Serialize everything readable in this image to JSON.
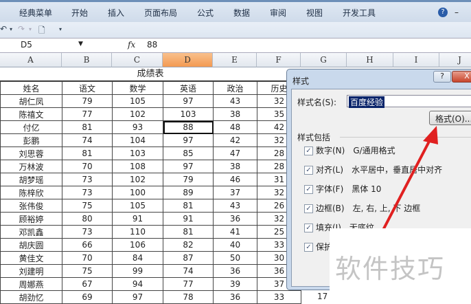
{
  "ribbon": {
    "tabs": [
      "经典菜单",
      "开始",
      "插入",
      "页面布局",
      "公式",
      "数据",
      "审阅",
      "视图",
      "开发工具"
    ],
    "help": "?",
    "minimize": "–"
  },
  "qat": {
    "undo": "↶",
    "undo_drop": "▾",
    "redo": "↷",
    "redo_drop": "▾",
    "preview": "🗋",
    "customize": "▾"
  },
  "formula_bar": {
    "name_box": "D5",
    "fx": "fx",
    "value": "88"
  },
  "columns": [
    "A",
    "B",
    "C",
    "D",
    "E",
    "F",
    "G",
    "H",
    "I",
    "J"
  ],
  "sheet": {
    "title": "成绩表",
    "headers": [
      "姓名",
      "语文",
      "数学",
      "英语",
      "政治",
      "历史"
    ],
    "rows": [
      [
        "胡仁凤",
        "79",
        "105",
        "97",
        "43",
        "32"
      ],
      [
        "陈禧文",
        "77",
        "102",
        "103",
        "38",
        "35"
      ],
      [
        "付亿",
        "81",
        "93",
        "88",
        "48",
        "42"
      ],
      [
        "彭鹏",
        "74",
        "104",
        "97",
        "42",
        "32"
      ],
      [
        "刘思蓉",
        "81",
        "103",
        "85",
        "47",
        "28"
      ],
      [
        "万林波",
        "70",
        "108",
        "97",
        "38",
        "28"
      ],
      [
        "胡梦瑶",
        "73",
        "102",
        "79",
        "46",
        "31"
      ],
      [
        "陈梓欣",
        "73",
        "100",
        "89",
        "37",
        "32"
      ],
      [
        "张伟俊",
        "75",
        "105",
        "81",
        "43",
        "26"
      ],
      [
        "顾裕婷",
        "80",
        "91",
        "91",
        "36",
        "32"
      ],
      [
        "邓凯鑫",
        "73",
        "110",
        "81",
        "41",
        "25"
      ],
      [
        "胡庆圆",
        "66",
        "106",
        "82",
        "40",
        "33"
      ],
      [
        "黄佳文",
        "70",
        "84",
        "87",
        "50",
        "30"
      ],
      [
        "刘建明",
        "75",
        "99",
        "74",
        "36",
        "36"
      ],
      [
        "周娜燕",
        "67",
        "94",
        "77",
        "39",
        "37"
      ],
      [
        "胡劲忆",
        "69",
        "97",
        "78",
        "36",
        "33"
      ]
    ],
    "g_partial": "17"
  },
  "dialog": {
    "title": "样式",
    "help": "?",
    "close": "X",
    "style_name_label": "样式名(S):",
    "style_name_value": "百度经验",
    "format_button": "格式(O)...",
    "group_label": "样式包括",
    "items": [
      {
        "label": "数字(N)",
        "desc": "G/通用格式",
        "checked": true
      },
      {
        "label": "对齐(L)",
        "desc": "水平居中，垂直居中对齐",
        "checked": true
      },
      {
        "label": "字体(F)",
        "desc": "黑体 10",
        "checked": true
      },
      {
        "label": "边框(B)",
        "desc": "左, 右, 上, 下 边框",
        "checked": true
      },
      {
        "label": "填充(I)",
        "desc": "无底纹",
        "checked": true
      },
      {
        "label": "保护",
        "desc": "",
        "checked": true
      }
    ]
  },
  "watermark": "软件技巧",
  "colors": {
    "arrow": "#e02020",
    "selected_col": "#f39a52"
  }
}
